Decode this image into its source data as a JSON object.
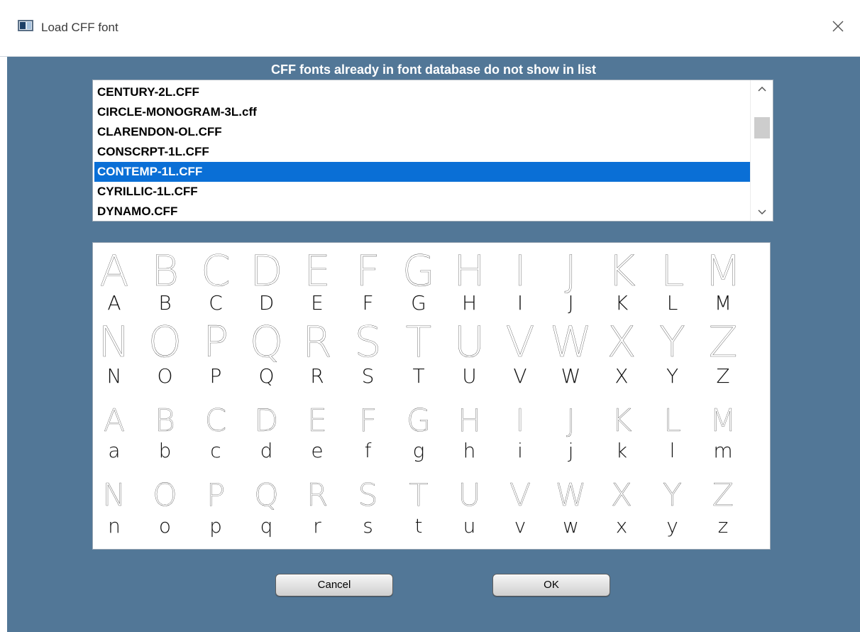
{
  "window": {
    "title": "Load CFF font",
    "title_icon": "application-window-icon",
    "close_icon": "close-icon"
  },
  "notice": "CFF fonts already in font database do not show in list",
  "font_list": {
    "items": [
      "CENTURY-2L.CFF",
      "CIRCLE-MONOGRAM-3L.cff",
      "CLARENDON-OL.CFF",
      "CONSCRPT-1L.CFF",
      "CONTEMP-1L.CFF",
      "CYRILLIC-1L.CFF",
      "DYNAMO.CFF"
    ],
    "selected": "CONTEMP-1L.CFF"
  },
  "preview": {
    "upper_row1": [
      "A",
      "B",
      "C",
      "D",
      "E",
      "F",
      "G",
      "H",
      "I",
      "J",
      "K",
      "L",
      "M"
    ],
    "upper_row2": [
      "N",
      "O",
      "P",
      "Q",
      "R",
      "S",
      "T",
      "U",
      "V",
      "W",
      "X",
      "Y",
      "Z"
    ],
    "lower_row1": [
      "a",
      "b",
      "c",
      "d",
      "e",
      "f",
      "g",
      "h",
      "i",
      "j",
      "k",
      "l",
      "m"
    ],
    "lower_row2": [
      "n",
      "o",
      "p",
      "q",
      "r",
      "s",
      "t",
      "u",
      "v",
      "w",
      "x",
      "y",
      "z"
    ]
  },
  "buttons": {
    "cancel_label": "Cancel",
    "ok_label": "OK"
  },
  "colors": {
    "dialog_background": "#527797",
    "selection": "#0a6fd6",
    "notice_text": "#ffffff"
  }
}
